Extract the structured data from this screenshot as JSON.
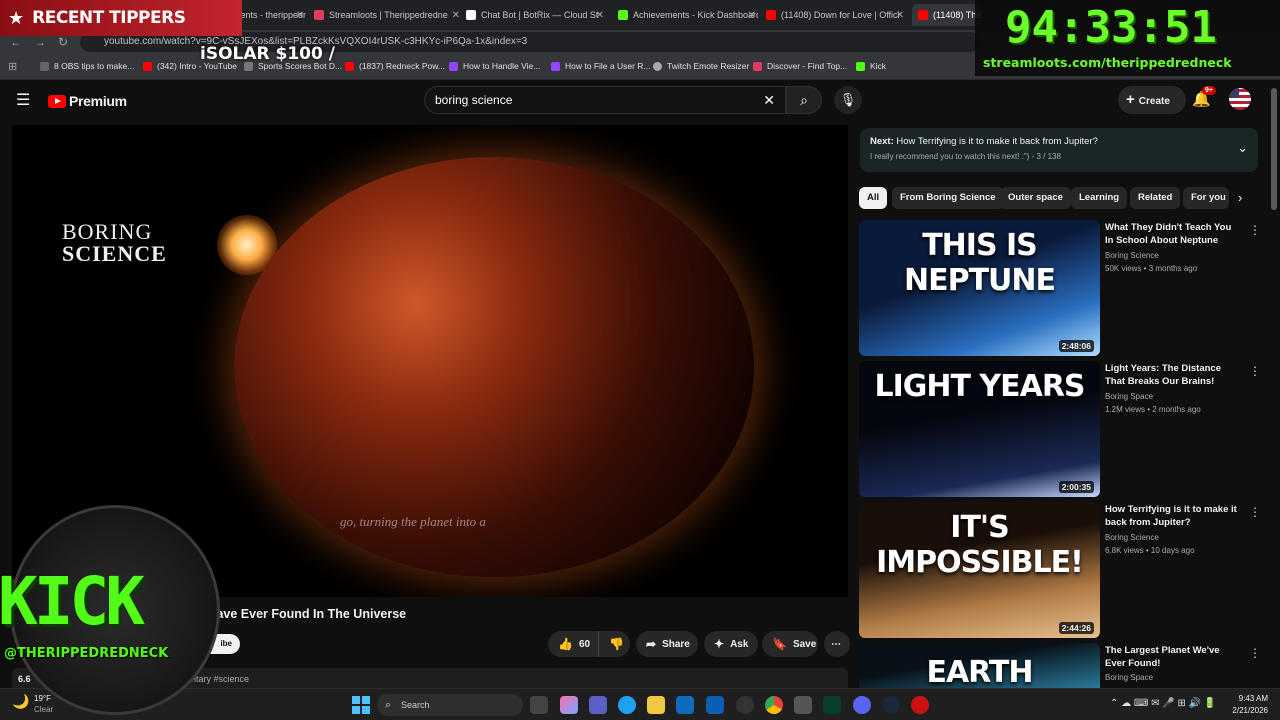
{
  "browser": {
    "tabs": [
      {
        "label": "StreamElements - therippedredn",
        "color": "#8a2a2a"
      },
      {
        "label": "Streamloots | Therippedredne",
        "color": "#e23a5f"
      },
      {
        "label": "Chat Bot | BotRix — Cloud St",
        "color": "#ffffff"
      },
      {
        "label": "Achievements - Kick Dashboard",
        "color": "#53fc18"
      },
      {
        "label": "(11408) Down for Love | Offici",
        "color": "#ff0000"
      },
      {
        "label": "(11408) The Most Bi",
        "color": "#ff0000"
      }
    ],
    "url": "youtube.com/watch?v=9C-vSsJEXos&list=PLBZckKsVQXOI4rUSK-c3HKYc-iP6Qa-1x&index=3",
    "bookmarks": [
      {
        "label": "8 OBS tips to make...",
        "color": "#666666"
      },
      {
        "label": "(342) Intro - YouTube",
        "color": "#ff0000"
      },
      {
        "label": "Sports Scores Bot D...",
        "color": "#777777"
      },
      {
        "label": "(1837) Redneck Pow...",
        "color": "#ff0000"
      },
      {
        "label": "How to Handle Vie...",
        "color": "#9146ff"
      },
      {
        "label": "How to File a User R...",
        "color": "#9146ff"
      },
      {
        "label": "Twitch Emote Resizer",
        "color": "#aaaaaa"
      },
      {
        "label": "Discover - Find Top...",
        "color": "#e23a5f"
      },
      {
        "label": "Kick",
        "color": "#53fc18"
      }
    ]
  },
  "youtube": {
    "logo_text": "Premium",
    "search_value": "boring science",
    "create_label": "Create",
    "notif_badge": "9+"
  },
  "video": {
    "brand_line1": "BORING",
    "brand_line2": "SCIENCE",
    "caption": "go, turning the planet into a",
    "title_visible": "lave Ever Found In The Universe",
    "subscribe_partial": "ibe",
    "likes": "60",
    "share": "Share",
    "ask": "Ask",
    "save": "Save",
    "desc_views_partial": "6.6",
    "desc_tags_partial": "entary #science"
  },
  "playlist": {
    "next_label": "Next:",
    "next_title": "How Terrifying is it to make it back from Jupiter?",
    "sub": "I really recommend you to watch this next! :\") - 3 / 138"
  },
  "chips": [
    "All",
    "From Boring Science",
    "Outer space",
    "Learning",
    "Related",
    "For you"
  ],
  "videos": [
    {
      "thumb_text": "THIS IS NEPTUNE",
      "duration": "2:48:06",
      "title": "What They Didn't Teach You In School About Neptune",
      "channel": "Boring Science",
      "meta": "50K views • 3 months ago",
      "colors": [
        "#0a1a3a",
        "#2a6fc0"
      ]
    },
    {
      "thumb_text": "LIGHT YEARS",
      "duration": "2:00:35",
      "title": "Light Years: The Distance That Breaks Our Brains!",
      "channel": "Boring Space",
      "meta": "1.2M views • 2 months ago",
      "colors": [
        "#05070f",
        "#1a2a55"
      ]
    },
    {
      "thumb_text": "IT'S IMPOSSIBLE!",
      "duration": "2:44:26",
      "title": "How Terrifying is it to make it back from Jupiter?",
      "channel": "Boring Science",
      "meta": "6.8K views • 10 days ago",
      "colors": [
        "#1a0f08",
        "#b07a45"
      ]
    },
    {
      "thumb_text": "EARTH",
      "duration": "",
      "title": "The Largest Planet We've Ever Found!",
      "channel": "Boring Space",
      "meta": "",
      "colors": [
        "#081018",
        "#2a7a9a"
      ]
    }
  ],
  "taskbar": {
    "temp": "19°F",
    "weather": "Clear",
    "search": "Search",
    "time": "9:43 AM",
    "date": "2/21/2026"
  },
  "overlay": {
    "recent_tippers": "RECENT TIPPERS",
    "solar": "iSOLAR $100 /",
    "timer": "94:33:51",
    "streamloots_url": "streamloots.com/therippedredneck",
    "kick": "KICK",
    "kick_handle": "@THERIPPEDREDNECK"
  }
}
